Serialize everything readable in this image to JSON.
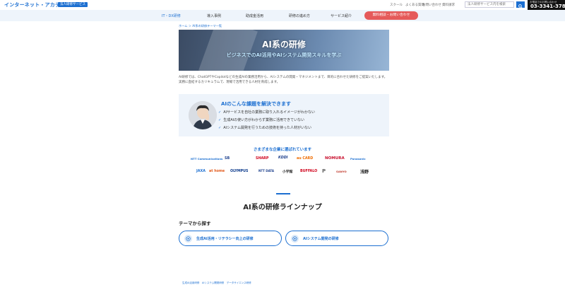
{
  "header": {
    "logo": "インターネット・アカデミー",
    "logo_badge": "法人研修サービス",
    "utility_links": [
      "スクール",
      "よくある質問",
      "お問い合わせ",
      "資料請求"
    ],
    "search_placeholder": "法人研修サービス内を検索",
    "phone_label": "お電話でのお問い合わせ",
    "phone_number": "03-3341-3781"
  },
  "nav": {
    "items": [
      "IT・DX研修",
      "導入事例",
      "助成金活用",
      "研修の進め方",
      "サービス紹介"
    ],
    "cta": "無料相談・お問い合わせ"
  },
  "breadcrumb": "ホーム ＞ AI系の研修テーマ一覧",
  "hero": {
    "title": "AI系の研修",
    "subtitle": "ビジネスでのAI活用やAIシステム開発スキルを学ぶ"
  },
  "intro": "AI研修では、ChatGPTやCopilotなどの生成AIの業務活用から、AIシステムの開発・マネジメントまで、目的に合わせた研修をご提案いたします。実務に直結するカリキュラムで、現場で活用できる人材を育成します。",
  "problems": {
    "title": "AIのこんな課題を解決できます",
    "items": [
      "AIサービスを自社の業務に取り入れるイメージがわかない",
      "生成AIの使い方がわからず業務に活用できていない",
      "AIシステム開発を行うための技術を持った人材がいない"
    ]
  },
  "clients": {
    "title": "さまざまな企業に選ばれています",
    "row1": [
      "NTT Communications",
      "SB",
      "SHARP",
      "KDDI",
      "au CARD",
      "NOMURA",
      "Panasonic"
    ],
    "row2": [
      "JAXA",
      "at home",
      "OLYMPUS",
      "NTT DATA",
      "小学館",
      "BUFFALO",
      "P",
      "SANYO",
      "浅野"
    ]
  },
  "lineup": {
    "title": "AI系の研修ラインナップ",
    "theme_label": "テーマから探す",
    "theme_buttons": [
      "生成AI活用・リテラシー向上の研修",
      "AIシステム開発の研修"
    ]
  },
  "bottom_links": "生成AI活用研修　AIシステム開発研修　データサイエンス研修",
  "colors": {
    "accent": "#1c6fd1",
    "cta": "#e55a5a",
    "nav_bg": "#eef4fb",
    "phone_bg": "#111111"
  },
  "icons": [
    "search-icon",
    "check-icon",
    "target-icon"
  ]
}
